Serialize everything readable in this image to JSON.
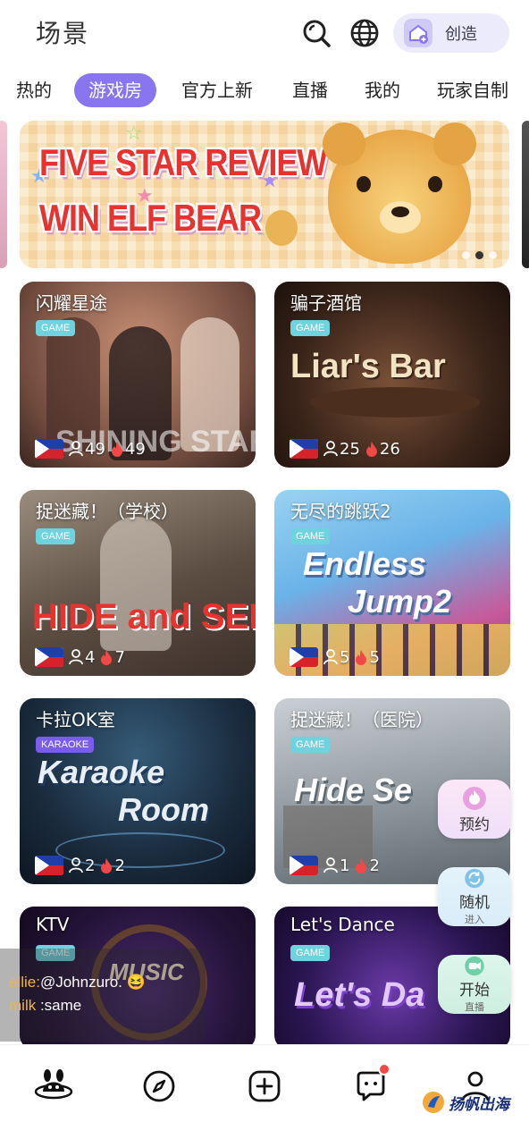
{
  "header": {
    "title": "场景",
    "create_label": "创造"
  },
  "tabs": [
    {
      "label": "热的"
    },
    {
      "label": "游戏房"
    },
    {
      "label": "官方上新"
    },
    {
      "label": "直播"
    },
    {
      "label": "我的"
    },
    {
      "label": "玩家自制"
    }
  ],
  "banner": {
    "line1": "FIVE STAR REVIEW",
    "line2": "WIN ELF BEAR",
    "active_slide": 2,
    "slide_count": 3
  },
  "cards": [
    {
      "title": "闪耀星途",
      "tag": "GAME",
      "art": "SHINING STAR",
      "flag": "philippines",
      "players": "49",
      "heat": "49"
    },
    {
      "title": "骗子酒馆",
      "tag": "GAME",
      "art": "Liar's Bar",
      "flag": "philippines",
      "players": "25",
      "heat": "26"
    },
    {
      "title": "捉迷藏！（学校）",
      "tag": "GAME",
      "art": "HIDE and SEEK",
      "flag": "philippines",
      "players": "4",
      "heat": "7"
    },
    {
      "title": "无尽的跳跃2",
      "tag": "GAME",
      "art_line1": "Endless",
      "art_line2": "Jump2",
      "flag": "philippines",
      "players": "5",
      "heat": "5"
    },
    {
      "title": "卡拉OK室",
      "tag": "KARAOKE",
      "art_line1": "Karaoke",
      "art_line2": "Room",
      "flag": "philippines",
      "players": "2",
      "heat": "2"
    },
    {
      "title": "捉迷藏！（医院）",
      "tag": "GAME",
      "art": "Hide Se",
      "flag": "philippines",
      "players": "1",
      "heat": "2"
    },
    {
      "title": "KTV",
      "tag": "GAME",
      "art": "MUSIC"
    },
    {
      "title": "Let's Dance",
      "tag": "GAME",
      "art": "Let's Da"
    }
  ],
  "fabs": {
    "reserve": {
      "label": "预约"
    },
    "random": {
      "label": "随机",
      "sub": "进入"
    },
    "start": {
      "label": "开始",
      "sub": "直播"
    }
  },
  "chat": [
    {
      "name": "ellie:",
      "text": "@Johnzuro.",
      "emoji": "😆"
    },
    {
      "name": "milk",
      "text": ":same"
    }
  ],
  "nav": {
    "items": [
      "home-icon",
      "discover-icon",
      "add-icon",
      "messages-icon",
      "profile-icon"
    ],
    "messages_badge": true
  },
  "watermark": {
    "text": "扬帆出海"
  },
  "colors": {
    "accent": "#8a75f0",
    "tag_game": "#6fd3df",
    "tag_karaoke": "#7b5cf0",
    "heat": "#f24848"
  }
}
